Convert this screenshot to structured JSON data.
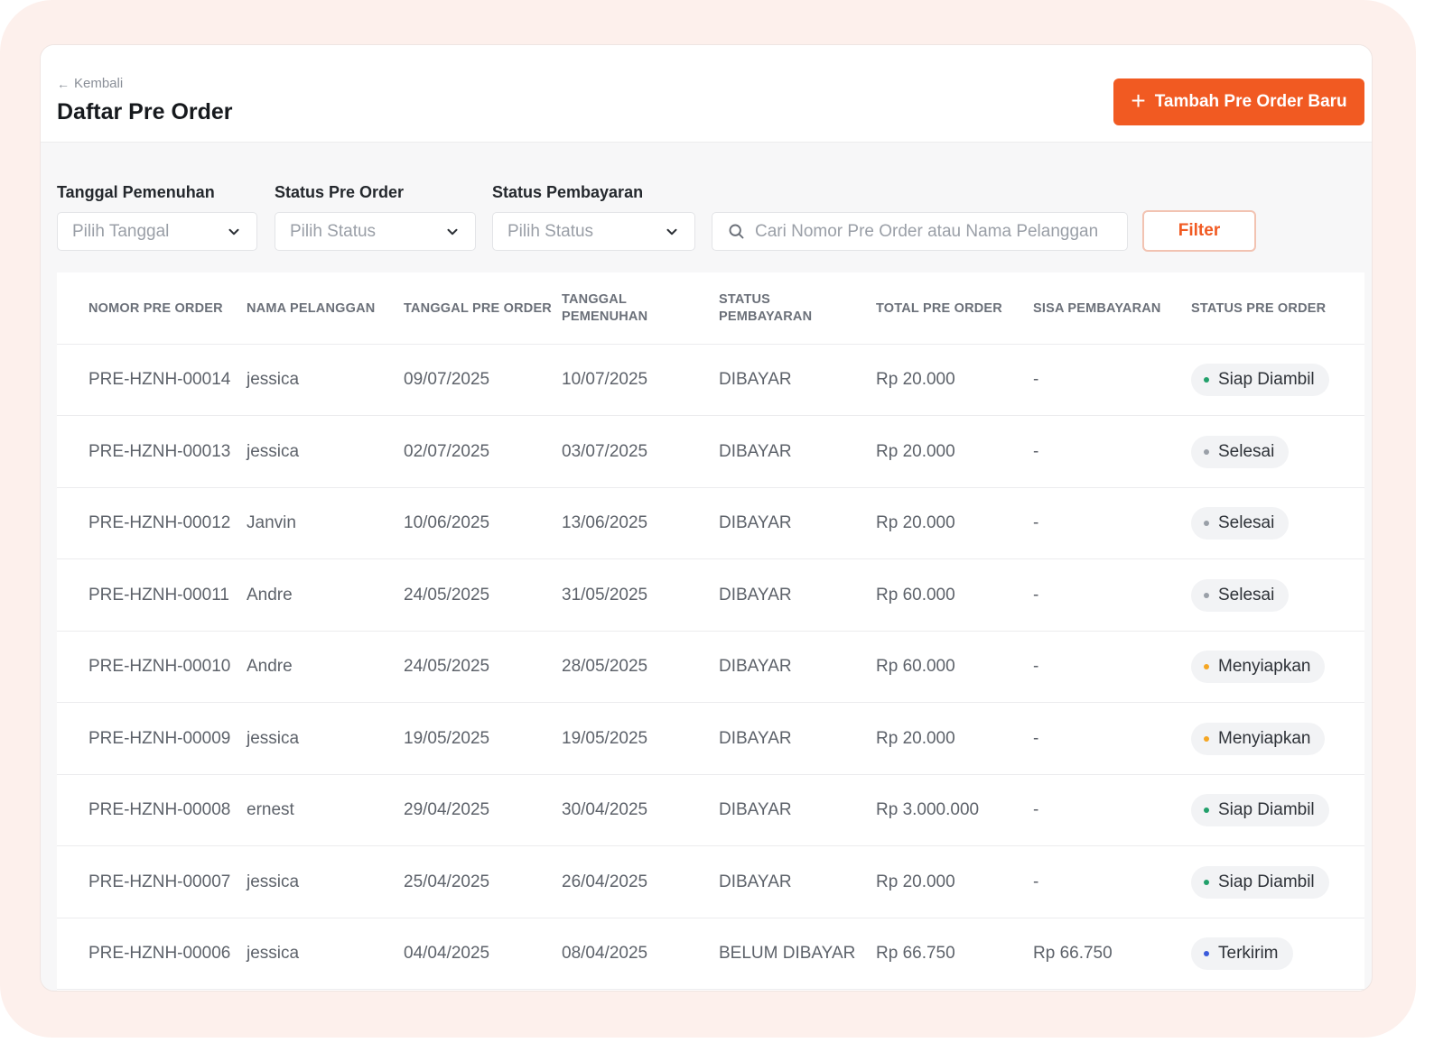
{
  "header": {
    "back_label": "Kembali",
    "title": "Daftar Pre Order",
    "add_button_label": "Tambah Pre Order Baru"
  },
  "filters": {
    "date": {
      "label": "Tanggal Pemenuhan",
      "placeholder": "Pilih Tanggal"
    },
    "po_status": {
      "label": "Status Pre Order",
      "placeholder": "Pilih Status"
    },
    "payment_status": {
      "label": "Status Pembayaran",
      "placeholder": "Pilih Status"
    },
    "search_placeholder": "Cari Nomor Pre Order atau Nama Pelanggan",
    "filter_button_label": "Filter"
  },
  "table": {
    "columns": [
      "NOMOR PRE ORDER",
      "NAMA PELANGGAN",
      "TANGGAL PRE ORDER",
      "TANGGAL PEMENUHAN",
      "STATUS PEMBAYARAN",
      "TOTAL PRE ORDER",
      "SISA PEMBAYARAN",
      "STATUS PRE ORDER"
    ],
    "rows": [
      [
        "PRE-HZNH-00014",
        "jessica",
        "09/07/2025",
        "10/07/2025",
        "DIBAYAR",
        "Rp 20.000",
        "-",
        "Siap Diambil"
      ],
      [
        "PRE-HZNH-00013",
        "jessica",
        "02/07/2025",
        "03/07/2025",
        "DIBAYAR",
        "Rp 20.000",
        "-",
        "Selesai"
      ],
      [
        "PRE-HZNH-00012",
        "Janvin",
        "10/06/2025",
        "13/06/2025",
        "DIBAYAR",
        "Rp 20.000",
        "-",
        "Selesai"
      ],
      [
        "PRE-HZNH-00011",
        "Andre",
        "24/05/2025",
        "31/05/2025",
        "DIBAYAR",
        "Rp 60.000",
        "-",
        "Selesai"
      ],
      [
        "PRE-HZNH-00010",
        "Andre",
        "24/05/2025",
        "28/05/2025",
        "DIBAYAR",
        "Rp 60.000",
        "-",
        "Menyiapkan"
      ],
      [
        "PRE-HZNH-00009",
        "jessica",
        "19/05/2025",
        "19/05/2025",
        "DIBAYAR",
        "Rp 20.000",
        "-",
        "Menyiapkan"
      ],
      [
        "PRE-HZNH-00008",
        "ernest",
        "29/04/2025",
        "30/04/2025",
        "DIBAYAR",
        "Rp 3.000.000",
        "-",
        "Siap Diambil"
      ],
      [
        "PRE-HZNH-00007",
        "jessica",
        "25/04/2025",
        "26/04/2025",
        "DIBAYAR",
        "Rp 20.000",
        "-",
        "Siap Diambil"
      ],
      [
        "PRE-HZNH-00006",
        "jessica",
        "04/04/2025",
        "08/04/2025",
        "BELUM DIBAYAR",
        "Rp 66.750",
        "Rp 66.750",
        "Terkirim"
      ]
    ]
  },
  "status_colors": {
    "Siap Diambil": "#22a06b",
    "Selesai": "#9aa0a8",
    "Menyiapkan": "#f5a623",
    "Terkirim": "#3b5bdb"
  },
  "colors": {
    "accent": "#f15a22",
    "frame_background": "#fdf0ec"
  },
  "icons": {
    "back": "arrow-left-icon",
    "add": "plus-icon",
    "dropdown": "chevron-down-icon",
    "search": "search-icon"
  }
}
